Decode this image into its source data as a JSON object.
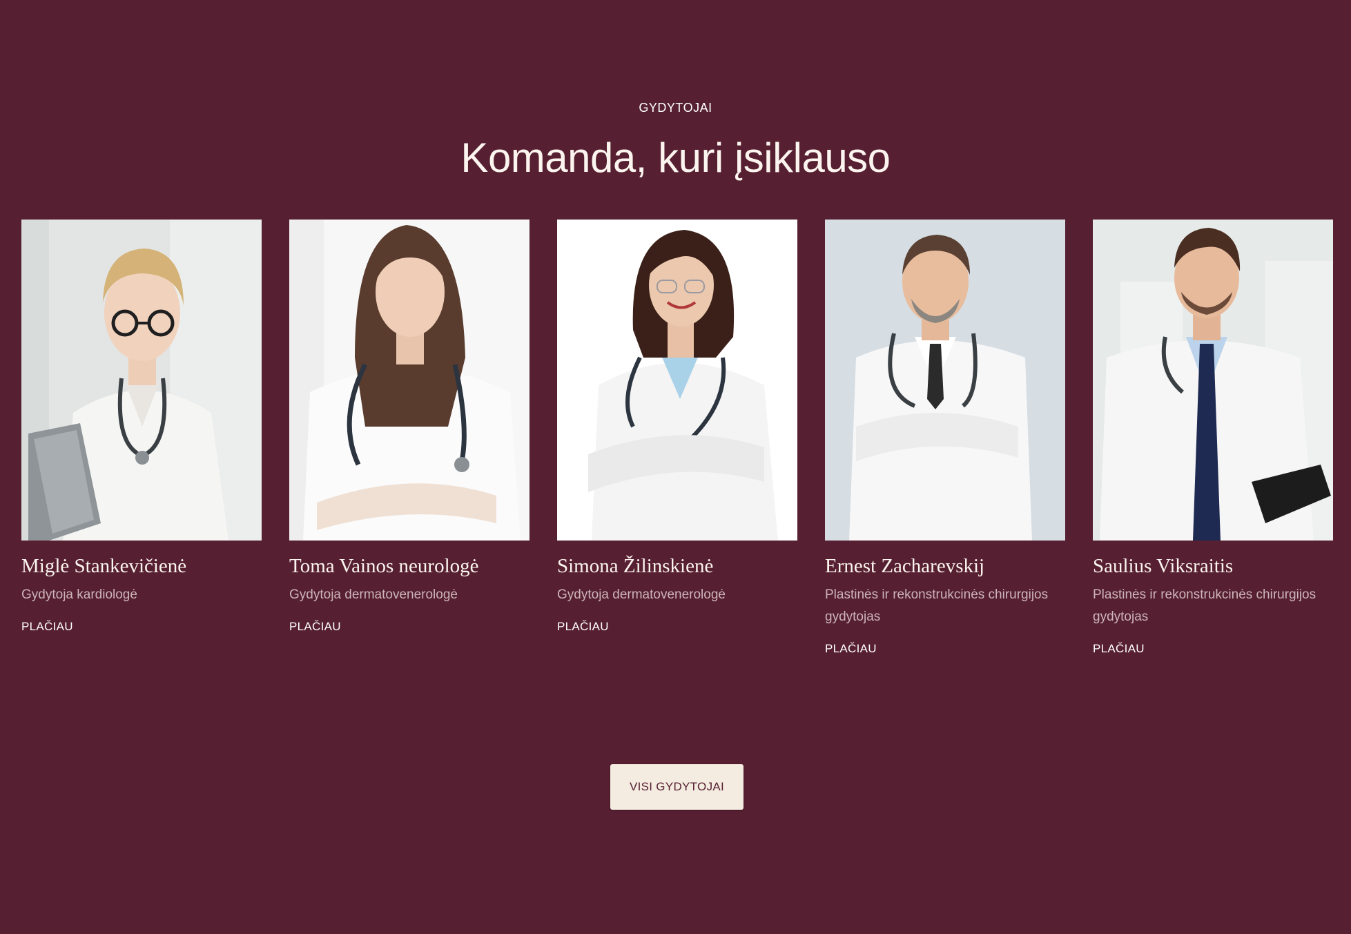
{
  "section": {
    "eyebrow": "GYDYTOJAI",
    "title": "Komanda, kuri įsiklauso"
  },
  "doctors": [
    {
      "name": "Miglė Stankevičienė",
      "role": "Gydytoja kardiologė",
      "link": "PLAČIAU",
      "photo": "female-doctor-glasses-clipboard-photo"
    },
    {
      "name": "Toma Vainos neurologė",
      "role": "Gydytoja dermatovenerologė",
      "link": "PLAČIAU",
      "photo": "female-doctor-stethoscope-photo"
    },
    {
      "name": "Simona Žilinskienė",
      "role": "Gydytoja dermatovenerologė",
      "link": "PLAČIAU",
      "photo": "smiling-female-doctor-photo"
    },
    {
      "name": "Ernest Zacharevskij",
      "role": "Plastinės ir rekonstrukcinės chirurgijos gydytojas",
      "link": "PLAČIAU",
      "photo": "male-doctor-arms-crossed-photo"
    },
    {
      "name": "Saulius Viksraitis",
      "role": "Plastinės ir rekonstrukcinės chirurgijos gydytojas",
      "link": "PLAČIAU",
      "photo": "male-doctor-tablet-photo"
    }
  ],
  "cta": {
    "label": "VISI GYDYTOJAI"
  },
  "colors": {
    "background": "#572032",
    "button": "#f4ebe1",
    "role_text": "#cdb4bb"
  }
}
